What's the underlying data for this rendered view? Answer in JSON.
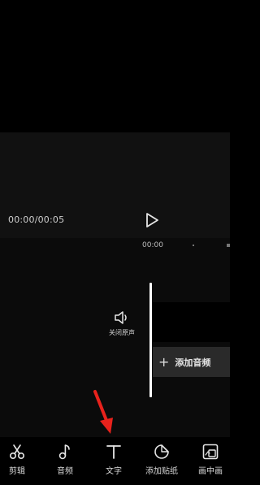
{
  "preview": {
    "time_display": "00:00/00:05"
  },
  "timeline": {
    "ruler_time": "00:00",
    "mute_label": "关闭原声",
    "add_audio_label": "添加音频"
  },
  "toolbar": {
    "items": [
      {
        "icon": "scissors-icon",
        "label": "剪辑"
      },
      {
        "icon": "music-note-icon",
        "label": "音频"
      },
      {
        "icon": "text-icon",
        "label": "文字"
      },
      {
        "icon": "sticker-icon",
        "label": "添加贴纸"
      },
      {
        "icon": "picture-in-picture-icon",
        "label": "画中画"
      }
    ]
  },
  "colors": {
    "background": "#000000",
    "panel": "#0b0b0b",
    "audio_track": "#2a2a2a",
    "pointer_arrow": "#e8221c",
    "playhead": "#ffffff"
  }
}
